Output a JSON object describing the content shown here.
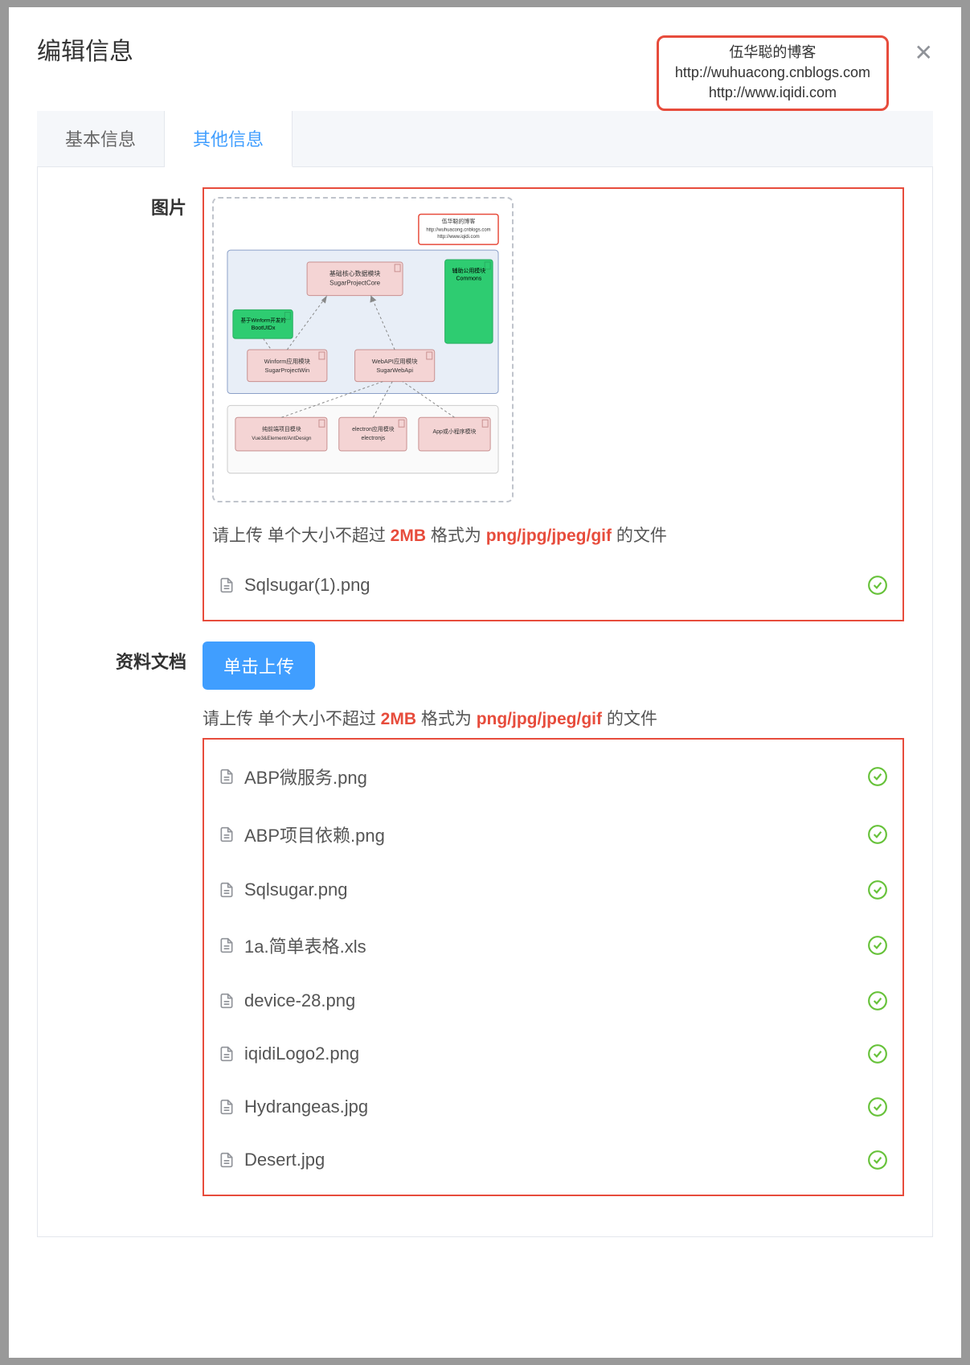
{
  "modal": {
    "title": "编辑信息"
  },
  "watermark": {
    "title": "伍华聪的博客",
    "url1": "http://wuhuacong.cnblogs.com",
    "url2": "http://www.iqidi.com"
  },
  "tabs": [
    {
      "label": "基本信息",
      "active": false
    },
    {
      "label": "其他信息",
      "active": true
    }
  ],
  "image_section": {
    "label": "图片",
    "diagram": {
      "watermark_title": "伍华聪的博客",
      "watermark_url1": "http://wuhuacong.cnblogs.com",
      "watermark_url2": "http://www.iqidi.com",
      "core": {
        "line1": "基础核心数据模块",
        "line2": "SugarProjectCore"
      },
      "common": {
        "line1": "辅助公用模块",
        "line2": "Commons"
      },
      "winform_app": {
        "line1": "基于Winform开发的",
        "line2": "BootUIDx"
      },
      "winform": {
        "line1": "Winform应用模块",
        "line2": "SugarProjectWin"
      },
      "webapi": {
        "line1": "WebAPI应用模块",
        "line2": "SugarWebApi"
      },
      "vue": {
        "line1": "纯前端项目模块",
        "line2": "Vue3&Element/AntDesign"
      },
      "electron": {
        "line1": "electron应用模块",
        "line2": "electronjs"
      },
      "app": {
        "line1": "App或小程序模块",
        "line2": ""
      }
    },
    "hint_prefix": "请上传 单个大小不超过 ",
    "hint_size": "2MB",
    "hint_mid": " 格式为 ",
    "hint_formats": "png/jpg/jpeg/gif",
    "hint_suffix": " 的文件",
    "files": [
      {
        "name": "Sqlsugar(1).png"
      }
    ]
  },
  "doc_section": {
    "label": "资料文档",
    "upload_btn": "单击上传",
    "hint_prefix": "请上传 单个大小不超过 ",
    "hint_size": "2MB",
    "hint_mid": " 格式为 ",
    "hint_formats": "png/jpg/jpeg/gif",
    "hint_suffix": " 的文件",
    "files": [
      {
        "name": "ABP微服务.png"
      },
      {
        "name": "ABP项目依赖.png"
      },
      {
        "name": "Sqlsugar.png"
      },
      {
        "name": "1a.简单表格.xls"
      },
      {
        "name": "device-28.png"
      },
      {
        "name": "iqidiLogo2.png"
      },
      {
        "name": "Hydrangeas.jpg"
      },
      {
        "name": "Desert.jpg"
      }
    ]
  }
}
